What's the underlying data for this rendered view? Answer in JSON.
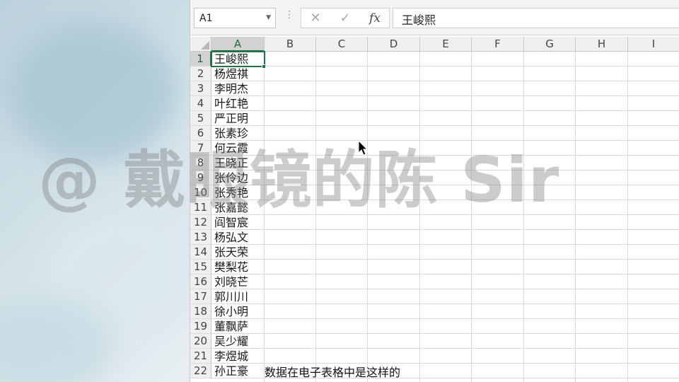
{
  "formula_bar": {
    "name_box": "A1",
    "name_box_dropdown_icon": "chevron-down-icon",
    "more_icon": "vertical-dots-icon",
    "cancel_icon": "close-icon",
    "cancel_glyph": "✕",
    "enter_icon": "check-icon",
    "enter_glyph": "✓",
    "function_icon": "fx-icon",
    "function_glyph": "fx",
    "content": "王峻熙"
  },
  "grid": {
    "selected_column": "A",
    "selected_row": 1,
    "active_cell": "A1",
    "columns": [
      "A",
      "B",
      "C",
      "D",
      "E",
      "F",
      "G",
      "H",
      "I"
    ],
    "rows": [
      {
        "num": "1",
        "a": "王峻熙"
      },
      {
        "num": "2",
        "a": "杨煜祺"
      },
      {
        "num": "3",
        "a": "李明杰"
      },
      {
        "num": "4",
        "a": "叶红艳"
      },
      {
        "num": "5",
        "a": "严正明"
      },
      {
        "num": "6",
        "a": "张素珍"
      },
      {
        "num": "7",
        "a": "何云霞"
      },
      {
        "num": "8",
        "a": "王晓正"
      },
      {
        "num": "9",
        "a": "张伶边"
      },
      {
        "num": "10",
        "a": "张秀艳"
      },
      {
        "num": "11",
        "a": "张嘉懿"
      },
      {
        "num": "12",
        "a": "阎智宸"
      },
      {
        "num": "13",
        "a": "杨弘文"
      },
      {
        "num": "14",
        "a": "张天荣"
      },
      {
        "num": "15",
        "a": "樊梨花"
      },
      {
        "num": "16",
        "a": "刘晓芒"
      },
      {
        "num": "17",
        "a": "郭川川"
      },
      {
        "num": "18",
        "a": "徐小明"
      },
      {
        "num": "19",
        "a": "董飘萨"
      },
      {
        "num": "20",
        "a": "吴少耀"
      },
      {
        "num": "21",
        "a": "李煜城"
      },
      {
        "num": "22",
        "a": "孙正豪"
      }
    ]
  },
  "watermark": "@ 戴眼镜的陈 Sir",
  "subtitle": "数据在电子表格中是这样的",
  "colors": {
    "excel_green": "#217346",
    "header_bg": "#efefef",
    "gridline": "#dadada"
  }
}
